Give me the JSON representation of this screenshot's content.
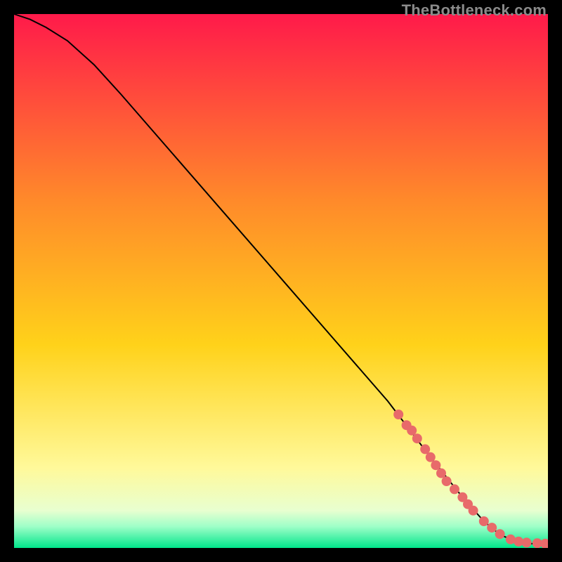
{
  "watermark": "TheBottleneck.com",
  "colors": {
    "gradient_top": "#ff1a4a",
    "gradient_mid1": "#ff6a2a",
    "gradient_mid2": "#ffd21a",
    "gradient_mid3": "#fff99a",
    "gradient_bottom_band": "#b8ffb8",
    "gradient_bottom": "#00e58a",
    "curve": "#000000",
    "marker": "#e86a6a",
    "frame_bg": "#000000"
  },
  "chart_data": {
    "type": "line",
    "title": "",
    "xlabel": "",
    "ylabel": "",
    "xlim": [
      0,
      100
    ],
    "ylim": [
      0,
      100
    ],
    "series": [
      {
        "name": "bottleneck-curve",
        "x": [
          0,
          3,
          6,
          10,
          15,
          20,
          30,
          40,
          50,
          60,
          70,
          78,
          84,
          88,
          91,
          94,
          97,
          99,
          100
        ],
        "y": [
          100,
          99,
          97.5,
          95,
          90.5,
          85,
          73.5,
          62,
          50.5,
          39,
          27.5,
          17,
          9.5,
          5,
          2.5,
          1.2,
          0.8,
          0.8,
          0.8
        ]
      }
    ],
    "markers": {
      "name": "highlighted-points",
      "x": [
        72,
        73.5,
        74.5,
        75.5,
        77,
        78,
        79,
        80,
        81,
        82.5,
        84,
        85,
        86,
        88,
        89.5,
        91,
        93,
        94.5,
        96,
        98,
        99.5
      ],
      "y": [
        25,
        23,
        22,
        20.5,
        18.5,
        17,
        15.5,
        14,
        12.5,
        11,
        9.5,
        8.2,
        7,
        5,
        3.8,
        2.6,
        1.6,
        1.2,
        1,
        0.9,
        0.8
      ]
    }
  }
}
